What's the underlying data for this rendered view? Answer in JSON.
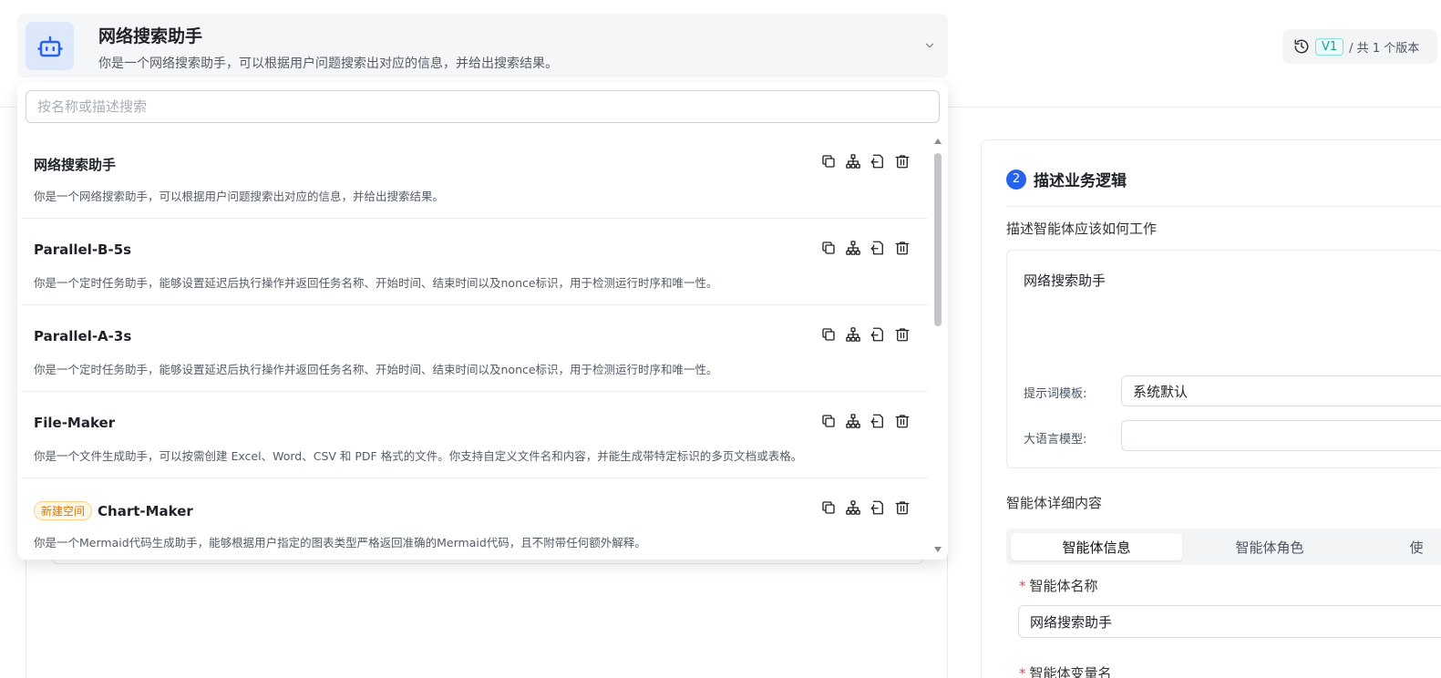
{
  "header": {
    "title": "网络搜索助手",
    "description": "你是一个网络搜索助手，可以根据用户问题搜索出对应的信息，并给出搜索结果。"
  },
  "version": {
    "tag": "V1",
    "total": "/ 共 1 个版本"
  },
  "search": {
    "placeholder": "按名称或描述搜索"
  },
  "agents": [
    {
      "name": "网络搜索助手",
      "badge": "",
      "description": "你是一个网络搜索助手，可以根据用户问题搜索出对应的信息，并给出搜索结果。"
    },
    {
      "name": "Parallel-B-5s",
      "badge": "",
      "description": "你是一个定时任务助手，能够设置延迟后执行操作并返回任务名称、开始时间、结束时间以及nonce标识，用于检测运行时序和唯一性。"
    },
    {
      "name": "Parallel-A-3s",
      "badge": "",
      "description": "你是一个定时任务助手，能够设置延迟后执行操作并返回任务名称、开始时间、结束时间以及nonce标识，用于检测运行时序和唯一性。"
    },
    {
      "name": "File-Maker",
      "badge": "",
      "description": "你是一个文件生成助手，可以按需创建 Excel、Word、CSV 和 PDF 格式的文件。你支持自定义文件名和内容，并能生成带特定标识的多页文档或表格。"
    },
    {
      "name": "Chart-Maker",
      "badge": "新建空间",
      "description": "你是一个Mermaid代码生成助手，能够根据用户指定的图表类型严格返回准确的Mermaid代码，且不附带任何额外解释。"
    }
  ],
  "right_panel": {
    "step_number": "2",
    "step_title": "描述业务逻辑",
    "subtitle": "描述智能体应该如何工作",
    "logic_text": "网络搜索助手",
    "prompt_template_label": "提示词模板:",
    "prompt_template_value": "系统默认",
    "llm_label": "大语言模型:",
    "llm_value": "",
    "detail_title": "智能体详细内容",
    "tabs": [
      "智能体信息",
      "智能体角色",
      "使"
    ],
    "name_label": "智能体名称",
    "name_value": "网络搜索助手",
    "var_label": "智能体变量名"
  },
  "colors": {
    "accent": "#2563eb",
    "version_tag": "#0fa39a",
    "badge": "#d97706",
    "required": "#ef4444"
  }
}
